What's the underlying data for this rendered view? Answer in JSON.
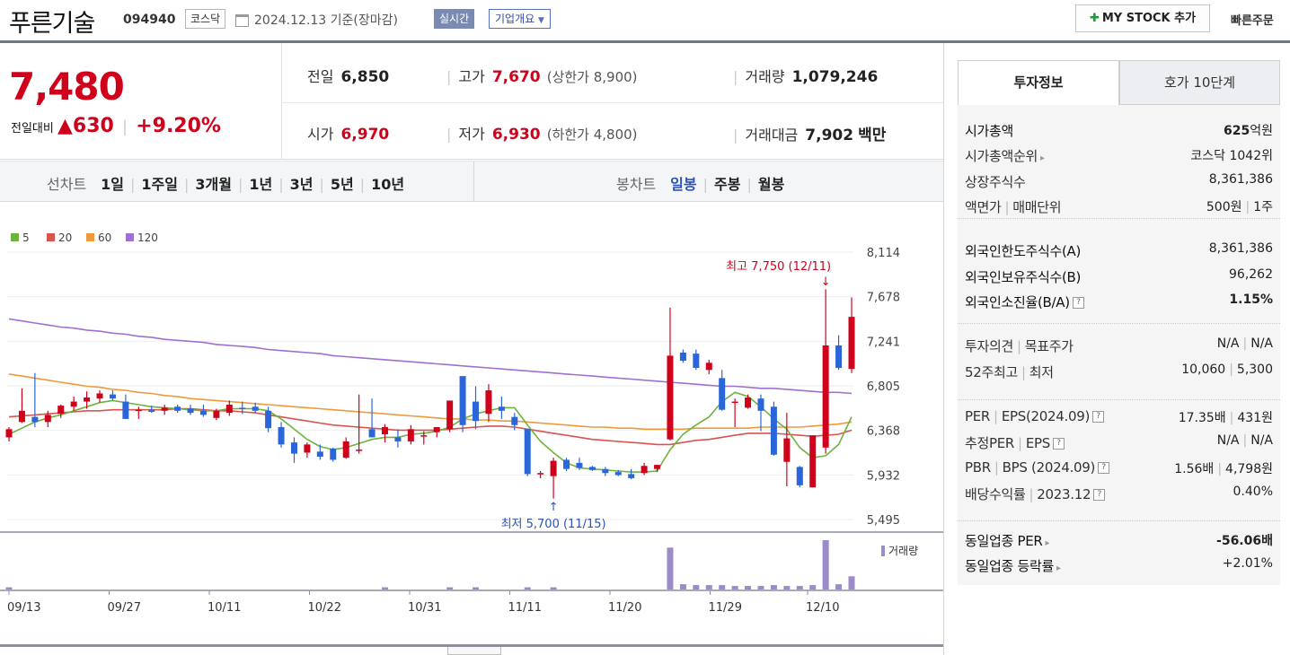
{
  "header": {
    "stock_name": "푸른기술",
    "stock_code": "094940",
    "market": "코스닥",
    "date_text": "2024.12.13  기준(장마감)",
    "realtime_label": "실시간",
    "company_overview_label": "기업개요",
    "mystock_label": "MY STOCK 추가",
    "quick_order_label": "빠른주문"
  },
  "price": {
    "current": "7,480",
    "change_label": "전일대비",
    "change_value": "630",
    "change_pct": "+9.20%"
  },
  "stats": {
    "prev_label": "전일",
    "prev_value": "6,850",
    "open_label": "시가",
    "open_value": "6,970",
    "high_label": "고가",
    "high_value": "7,670",
    "upper_limit": "(상한가 8,900)",
    "low_label": "저가",
    "low_value": "6,930",
    "lower_limit": "(하한가 4,800)",
    "volume_label": "거래량",
    "volume_value": "1,079,246",
    "amount_label": "거래대금",
    "amount_value": "7,902",
    "amount_unit": "백만"
  },
  "chart_toolbar": {
    "line_title": "선차트",
    "line_periods": [
      "1일",
      "1주일",
      "3개월",
      "1년",
      "3년",
      "5년",
      "10년"
    ],
    "candle_title": "봉차트",
    "candle_periods": [
      "일봉",
      "주봉",
      "월봉"
    ],
    "candle_selected": "일봉"
  },
  "chart_data": {
    "type": "candlestick",
    "ma_legend": [
      {
        "name": "5",
        "color": "#6cb33f"
      },
      {
        "name": "20",
        "color": "#d9534f"
      },
      {
        "name": "60",
        "color": "#ef9a3a"
      },
      {
        "name": "120",
        "color": "#a070d0"
      }
    ],
    "y_ticks": [
      "8,114",
      "7,678",
      "7,241",
      "6,805",
      "6,368",
      "5,932",
      "5,495"
    ],
    "ylim": [
      5495,
      8114
    ],
    "x_ticks": [
      "09/13",
      "09/27",
      "10/11",
      "10/22",
      "10/31",
      "11/11",
      "11/20",
      "11/29",
      "12/10"
    ],
    "high_annotation": "최고 7,750 (12/11)",
    "low_annotation": "최저 5,700 (11/15)",
    "volume_label": "거래량",
    "up_color": "#d0021b",
    "down_color": "#2a66d9",
    "candles": [
      [
        6300,
        6400,
        6260,
        6380
      ],
      [
        6450,
        6780,
        6440,
        6560
      ],
      [
        6500,
        6930,
        6400,
        6450
      ],
      [
        6450,
        6560,
        6400,
        6520
      ],
      [
        6530,
        6620,
        6490,
        6610
      ],
      [
        6600,
        6700,
        6560,
        6650
      ],
      [
        6650,
        6750,
        6580,
        6690
      ],
      [
        6680,
        6760,
        6640,
        6730
      ],
      [
        6720,
        6760,
        6660,
        6680
      ],
      [
        6650,
        6720,
        6480,
        6480
      ],
      [
        6560,
        6600,
        6480,
        6570
      ],
      [
        6570,
        6610,
        6540,
        6550
      ],
      [
        6560,
        6620,
        6520,
        6590
      ],
      [
        6600,
        6620,
        6540,
        6560
      ],
      [
        6580,
        6620,
        6520,
        6540
      ],
      [
        6560,
        6620,
        6500,
        6520
      ],
      [
        6490,
        6580,
        6470,
        6560
      ],
      [
        6540,
        6660,
        6510,
        6620
      ],
      [
        6590,
        6650,
        6530,
        6580
      ],
      [
        6600,
        6640,
        6540,
        6560
      ],
      [
        6560,
        6600,
        6350,
        6390
      ],
      [
        6400,
        6450,
        6200,
        6230
      ],
      [
        6250,
        6300,
        6050,
        6140
      ],
      [
        6150,
        6250,
        6100,
        6230
      ],
      [
        6160,
        6230,
        6080,
        6110
      ],
      [
        6190,
        6200,
        6060,
        6080
      ],
      [
        6100,
        6300,
        6090,
        6260
      ],
      [
        6170,
        6720,
        6140,
        6180
      ],
      [
        6380,
        6680,
        6300,
        6300
      ],
      [
        6330,
        6430,
        6250,
        6400
      ],
      [
        6300,
        6380,
        6200,
        6260
      ],
      [
        6260,
        6420,
        6230,
        6380
      ],
      [
        6320,
        6360,
        6230,
        6320
      ],
      [
        6350,
        6400,
        6300,
        6400
      ],
      [
        6380,
        6600,
        6350,
        6660
      ],
      [
        6900,
        6700,
        6350,
        6420
      ],
      [
        6650,
        6800,
        6380,
        6460
      ],
      [
        6530,
        6820,
        6450,
        6760
      ],
      [
        6600,
        6700,
        6480,
        6560
      ],
      [
        6500,
        6540,
        6370,
        6420
      ],
      [
        6380,
        6380,
        5920,
        5940
      ],
      [
        5950,
        5970,
        5900,
        5950
      ],
      [
        5920,
        6100,
        5700,
        6070
      ],
      [
        6080,
        6100,
        5970,
        5990
      ],
      [
        6050,
        6100,
        5980,
        6000
      ],
      [
        6010,
        6020,
        5970,
        5980
      ],
      [
        5990,
        6010,
        5920,
        5950
      ],
      [
        5960,
        5980,
        5920,
        5930
      ],
      [
        5940,
        5990,
        5890,
        5900
      ],
      [
        5950,
        6050,
        5930,
        6020
      ],
      [
        5990,
        6030,
        5960,
        6030
      ],
      [
        6280,
        7570,
        6270,
        7100
      ],
      [
        7130,
        7160,
        7030,
        7050
      ],
      [
        7120,
        7160,
        6960,
        6980
      ],
      [
        6960,
        7060,
        6920,
        7030
      ],
      [
        6880,
        6960,
        6560,
        6570
      ],
      [
        6640,
        6680,
        6400,
        6650
      ],
      [
        6590,
        6720,
        6580,
        6690
      ],
      [
        6680,
        6720,
        6360,
        6560
      ],
      [
        6600,
        6650,
        6120,
        6130
      ],
      [
        6060,
        6540,
        5820,
        6290
      ],
      [
        6010,
        6020,
        5810,
        5830
      ],
      [
        5810,
        6300,
        5810,
        6320
      ],
      [
        6200,
        7750,
        6140,
        7200
      ],
      [
        7200,
        7300,
        6960,
        6980
      ],
      [
        6970,
        7670,
        6930,
        7480
      ]
    ],
    "volumes": [
      5,
      0,
      0,
      0,
      0,
      0,
      0,
      0,
      0,
      0,
      0,
      0,
      0,
      0,
      0,
      0,
      0,
      0,
      0,
      0,
      0,
      0,
      0,
      0,
      0,
      0,
      0,
      0,
      0,
      5,
      0,
      0,
      0,
      0,
      5,
      0,
      5,
      0,
      0,
      0,
      5,
      0,
      5,
      0,
      0,
      0,
      0,
      0,
      0,
      0,
      0,
      95,
      12,
      10,
      10,
      10,
      8,
      8,
      8,
      10,
      8,
      8,
      10,
      112,
      12,
      30
    ],
    "ma5": [
      6330,
      6390,
      6450,
      6490,
      6520,
      6560,
      6600,
      6640,
      6660,
      6640,
      6620,
      6600,
      6590,
      6580,
      6570,
      6560,
      6560,
      6580,
      6580,
      6580,
      6560,
      6480,
      6380,
      6280,
      6210,
      6180,
      6200,
      6240,
      6280,
      6300,
      6300,
      6330,
      6340,
      6360,
      6400,
      6480,
      6530,
      6560,
      6590,
      6590,
      6420,
      6260,
      6150,
      6050,
      6000,
      5990,
      5980,
      5970,
      5960,
      5960,
      5970,
      6180,
      6330,
      6420,
      6500,
      6650,
      6740,
      6700,
      6600,
      6480,
      6380,
      6200,
      6100,
      6120,
      6230,
      6500
    ],
    "ma20": [
      6500,
      6510,
      6520,
      6530,
      6540,
      6550,
      6560,
      6560,
      6570,
      6570,
      6570,
      6570,
      6570,
      6580,
      6580,
      6570,
      6560,
      6560,
      6550,
      6540,
      6520,
      6500,
      6480,
      6460,
      6440,
      6420,
      6410,
      6400,
      6390,
      6380,
      6370,
      6370,
      6370,
      6370,
      6380,
      6390,
      6400,
      6410,
      6410,
      6400,
      6380,
      6360,
      6340,
      6320,
      6300,
      6280,
      6270,
      6260,
      6250,
      6240,
      6230,
      6230,
      6250,
      6270,
      6280,
      6300,
      6320,
      6340,
      6340,
      6340,
      6330,
      6320,
      6310,
      6320,
      6330,
      6370
    ],
    "ma60": [
      6920,
      6900,
      6880,
      6860,
      6840,
      6820,
      6800,
      6790,
      6770,
      6760,
      6740,
      6730,
      6710,
      6700,
      6680,
      6670,
      6660,
      6650,
      6640,
      6630,
      6620,
      6610,
      6600,
      6590,
      6580,
      6570,
      6560,
      6550,
      6540,
      6530,
      6520,
      6510,
      6500,
      6490,
      6480,
      6480,
      6470,
      6470,
      6460,
      6460,
      6450,
      6440,
      6430,
      6420,
      6410,
      6400,
      6400,
      6390,
      6390,
      6380,
      6380,
      6380,
      6380,
      6390,
      6390,
      6390,
      6390,
      6390,
      6400,
      6400,
      6400,
      6400,
      6410,
      6420,
      6430,
      6450
    ],
    "ma120": [
      7460,
      7440,
      7420,
      7400,
      7380,
      7370,
      7350,
      7340,
      7320,
      7310,
      7290,
      7280,
      7260,
      7250,
      7240,
      7230,
      7210,
      7200,
      7190,
      7180,
      7160,
      7150,
      7140,
      7130,
      7120,
      7100,
      7090,
      7080,
      7070,
      7060,
      7050,
      7040,
      7030,
      7020,
      7010,
      7000,
      6990,
      6980,
      6970,
      6960,
      6950,
      6940,
      6930,
      6920,
      6910,
      6900,
      6890,
      6880,
      6870,
      6860,
      6850,
      6840,
      6830,
      6820,
      6810,
      6800,
      6800,
      6790,
      6780,
      6780,
      6770,
      6760,
      6750,
      6740,
      6740,
      6730
    ]
  },
  "info_tabs": [
    "투자정보",
    "호가 10단계"
  ],
  "invest_info": {
    "market_cap_label": "시가총액",
    "market_cap_value": "625",
    "market_cap_unit": "억원",
    "rank_label": "시가총액순위",
    "rank_value": "코스닥 1042위",
    "shares_label": "상장주식수",
    "shares_value": "8,361,386",
    "par_label": "액면가",
    "trade_unit_label": "매매단위",
    "par_value": "500원",
    "trade_unit_value": "1주",
    "foreign_limit_label": "외국인한도주식수(A)",
    "foreign_limit_value": "8,361,386",
    "foreign_hold_label": "외국인보유주식수(B)",
    "foreign_hold_value": "96,262",
    "foreign_ratio_label": "외국인소진율(B/A)",
    "foreign_ratio_value": "1.15%",
    "opinion_label": "투자의견",
    "target_label": "목표주가",
    "opinion_value": "N/A",
    "target_value": "N/A",
    "w52_high_label": "52주최고",
    "w52_low_label": "최저",
    "w52_high_value": "10,060",
    "w52_low_value": "5,300",
    "per_label": "PER",
    "eps_label": "EPS(2024.09)",
    "per_value": "17.35배",
    "eps_value": "431원",
    "est_per_label": "추정PER",
    "est_eps_label": "EPS",
    "est_per_value": "N/A",
    "est_eps_value": "N/A",
    "pbr_label": "PBR",
    "bps_label": "BPS (2024.09)",
    "pbr_value": "1.56배",
    "bps_value": "4,798원",
    "div_label": "배당수익률",
    "div_year": "2023.12",
    "div_value": "0.40%",
    "sector_per_label": "동일업종 PER",
    "sector_per_value": "-56.06배",
    "sector_chg_label": "동일업종 등락률",
    "sector_chg_value": "+2.01%"
  }
}
